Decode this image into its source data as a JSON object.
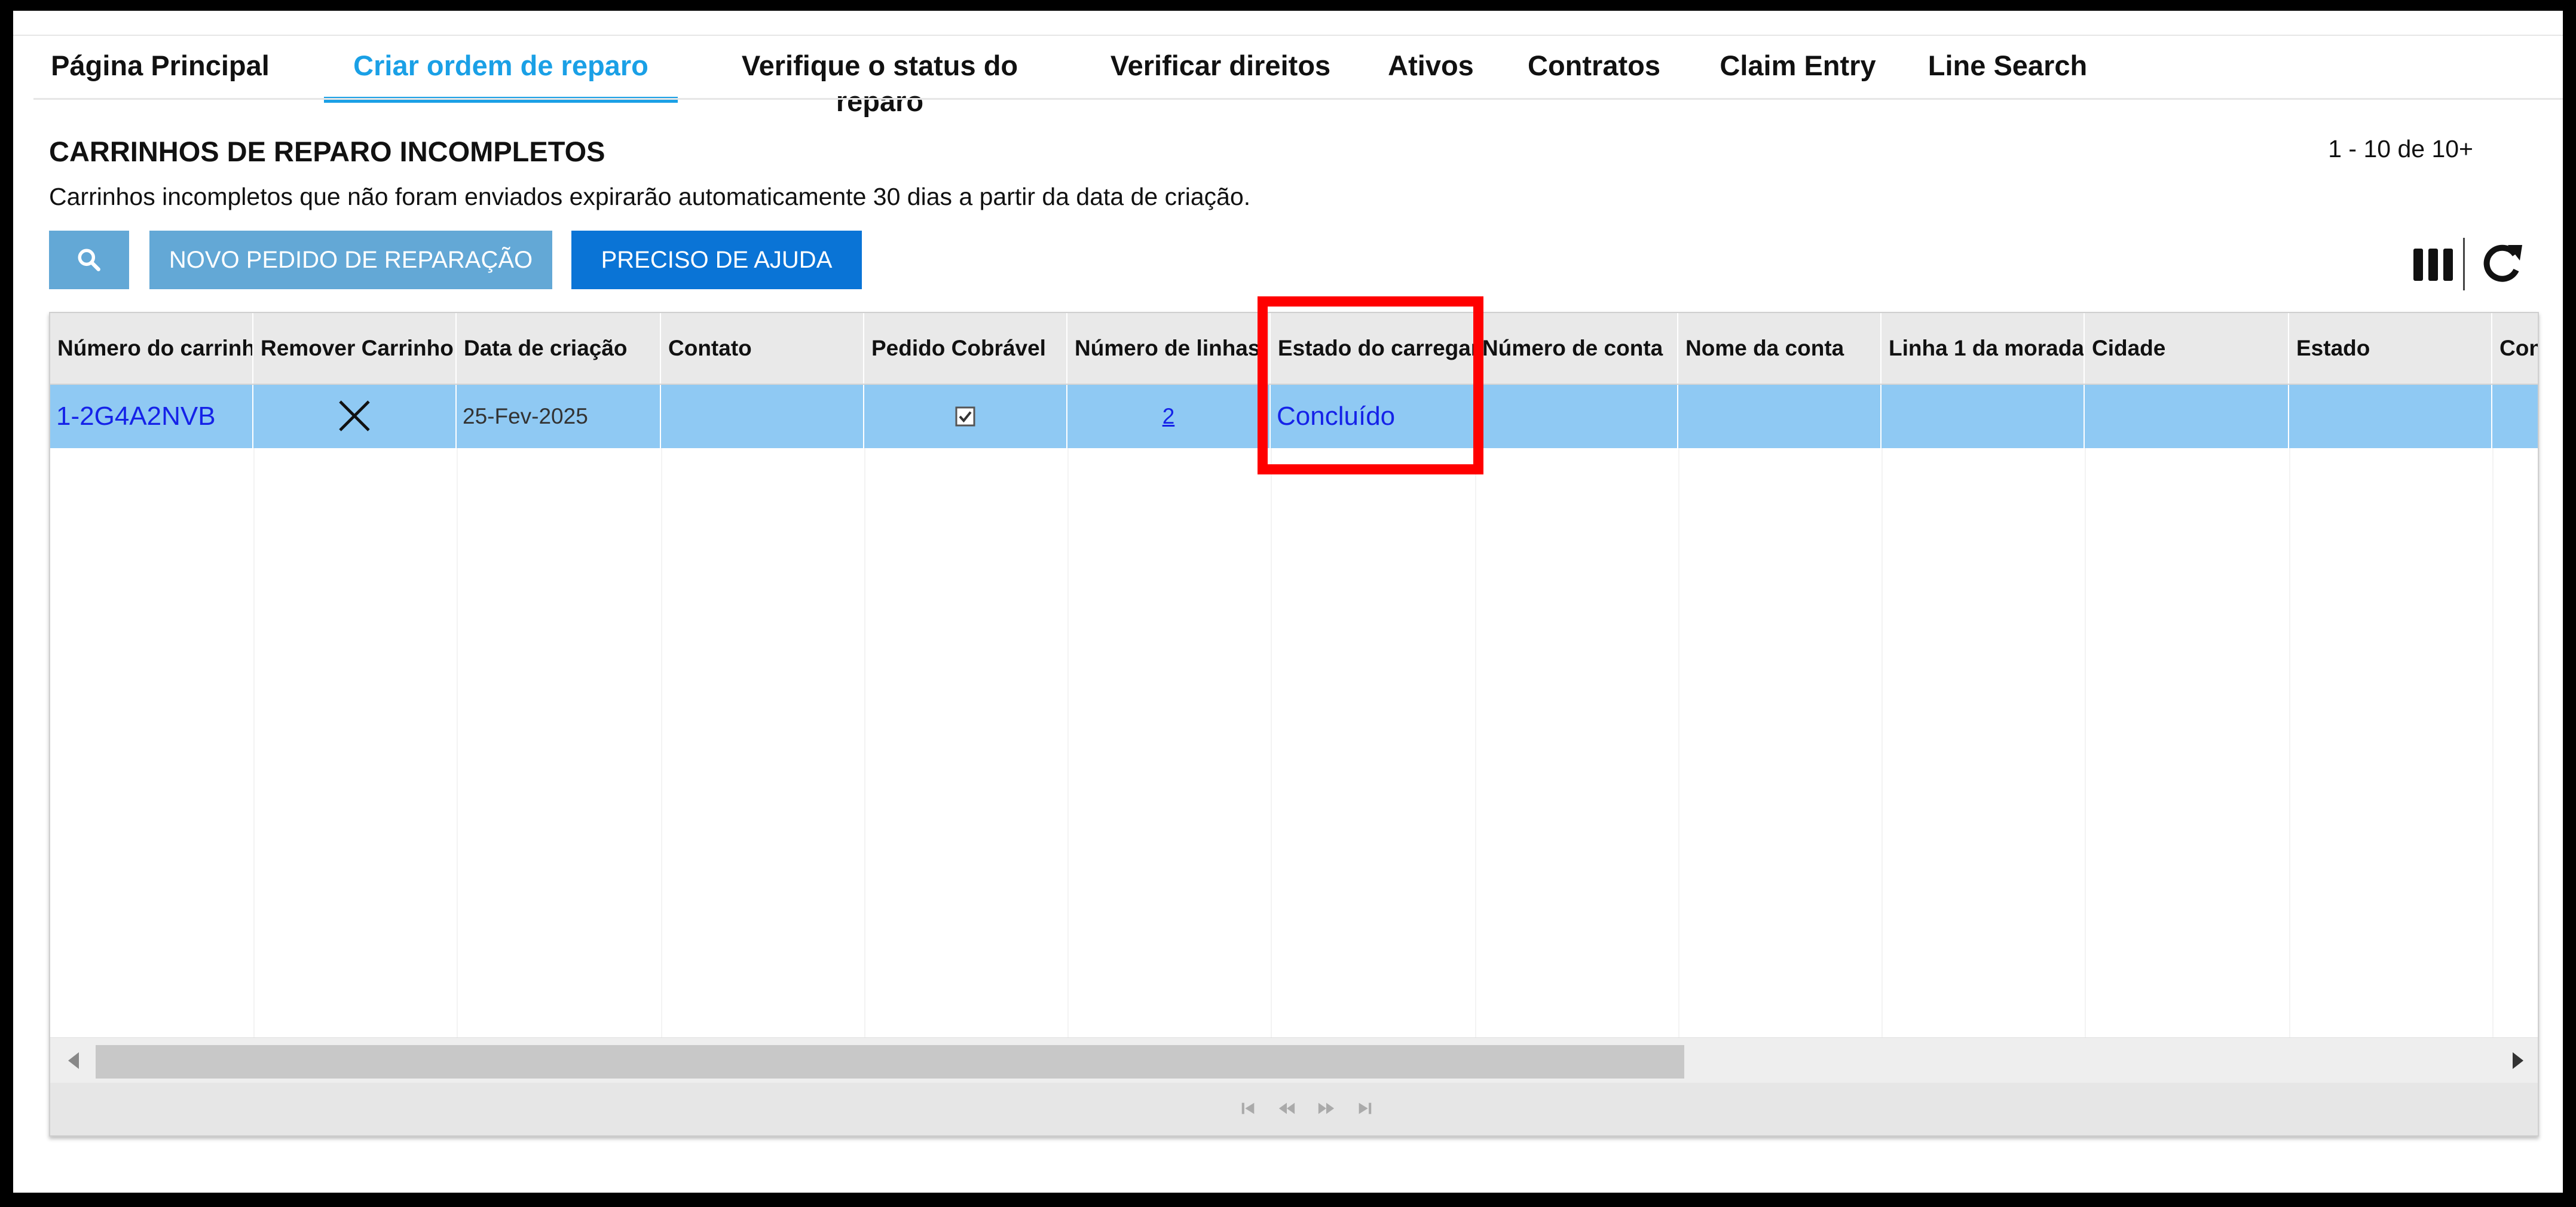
{
  "nav": {
    "tabs": [
      {
        "label": "Página Principal",
        "active": false
      },
      {
        "label": "Criar ordem de reparo",
        "active": true
      },
      {
        "label": "Verifique o status do reparo",
        "active": false
      },
      {
        "label": "Verificar direitos",
        "active": false
      },
      {
        "label": "Ativos",
        "active": false
      },
      {
        "label": "Contratos",
        "active": false
      },
      {
        "label": "Claim Entry",
        "active": false
      },
      {
        "label": "Line Search",
        "active": false
      }
    ]
  },
  "page": {
    "title": "CARRINHOS DE REPARO INCOMPLETOS",
    "subtitle": "Carrinhos incompletos que não foram enviados expirarão automaticamente 30 dias a partir da data de criação.",
    "pager": "1 - 10 de 10+"
  },
  "toolbar": {
    "search_icon": "search-icon",
    "new_order_label": "NOVO PEDIDO DE REPARAÇÃO",
    "help_label": "PRECISO DE AJUDA",
    "columns_icon": "columns-icon",
    "refresh_icon": "refresh-icon"
  },
  "table": {
    "headers": [
      "Número do carrinho",
      "Remover Carrinho",
      "Data de criação",
      "Contato",
      "Pedido Cobrável",
      "Número de linhas",
      "Estado do carregamento",
      "Número de conta",
      "Nome da conta",
      "Linha 1 da morada",
      "Cidade",
      "Estado",
      "Con"
    ],
    "rows": [
      {
        "cart_number": "1-2G4A2NVB",
        "remove": "close-icon",
        "created": "25-Fev-2025",
        "contact": "",
        "billable": true,
        "lines": "2",
        "status": "Concluído",
        "account_number": "",
        "account_name": "",
        "address1": "",
        "city": "",
        "state": ""
      }
    ]
  },
  "colors": {
    "accent": "#1aa0e6",
    "button_light": "#63a8d6",
    "button_primary": "#0a74d6",
    "selected_row": "#8fc9f3",
    "link": "#1522e8",
    "highlight": "#ff0000"
  }
}
